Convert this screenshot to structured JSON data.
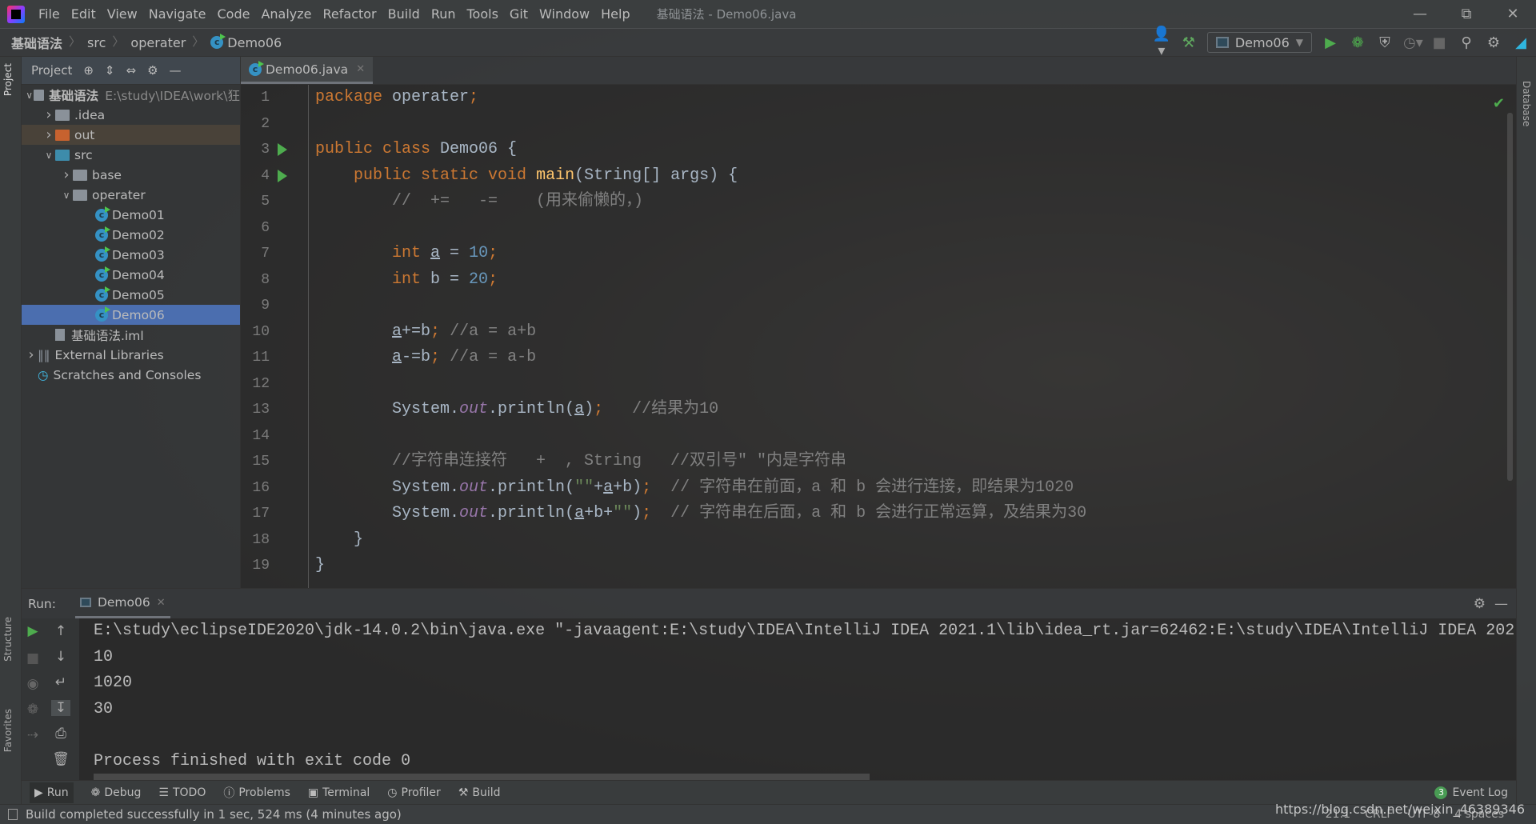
{
  "titlebar": {
    "menu": [
      "File",
      "Edit",
      "View",
      "Navigate",
      "Code",
      "Analyze",
      "Refactor",
      "Build",
      "Run",
      "Tools",
      "Git",
      "Window",
      "Help"
    ],
    "title": "基础语法 - Demo06.java"
  },
  "navbar": {
    "breadcrumbs": [
      "基础语法",
      "src",
      "operater",
      "Demo06"
    ],
    "run_config": "Demo06"
  },
  "side_tabs": {
    "project": "Project",
    "structure": "Structure",
    "favorites": "Favorites",
    "database": "Database"
  },
  "project": {
    "header": "Project",
    "tree": [
      {
        "label": "基础语法",
        "hint": "E:\\study\\IDEA\\work\\狂",
        "depth": 0,
        "arrow": "down",
        "icon": "module-folder"
      },
      {
        "label": ".idea",
        "depth": 1,
        "arrow": "right",
        "icon": "folder"
      },
      {
        "label": "out",
        "depth": 1,
        "arrow": "right",
        "icon": "folder-orange"
      },
      {
        "label": "src",
        "depth": 1,
        "arrow": "down",
        "icon": "folder-blue"
      },
      {
        "label": "base",
        "depth": 2,
        "arrow": "right",
        "icon": "package"
      },
      {
        "label": "operater",
        "depth": 2,
        "arrow": "down",
        "icon": "package"
      },
      {
        "label": "Demo01",
        "depth": 3,
        "icon": "class"
      },
      {
        "label": "Demo02",
        "depth": 3,
        "icon": "class"
      },
      {
        "label": "Demo03",
        "depth": 3,
        "icon": "class"
      },
      {
        "label": "Demo04",
        "depth": 3,
        "icon": "class"
      },
      {
        "label": "Demo05",
        "depth": 3,
        "icon": "class"
      },
      {
        "label": "Demo06",
        "depth": 3,
        "icon": "class",
        "selected": true
      },
      {
        "label": "基础语法.iml",
        "depth": 1,
        "icon": "iml-file"
      },
      {
        "label": "External Libraries",
        "depth": 0,
        "arrow": "right",
        "icon": "libraries"
      },
      {
        "label": "Scratches and Consoles",
        "depth": 0,
        "icon": "scratches"
      }
    ]
  },
  "editor": {
    "tab": "Demo06.java",
    "run_markers": [
      3,
      4
    ],
    "lines": [
      [
        [
          "kw",
          "package "
        ],
        [
          "t",
          "operater"
        ],
        [
          "kw",
          ";"
        ]
      ],
      [],
      [
        [
          "kw",
          "public class "
        ],
        [
          "t",
          "Demo06 {"
        ]
      ],
      [
        [
          "t",
          "    "
        ],
        [
          "kw",
          "public static void "
        ],
        [
          "fn",
          "main"
        ],
        [
          "t",
          "(String[] args) {"
        ]
      ],
      [
        [
          "cm",
          "        //  +=   -=    (用来偷懒的，)"
        ]
      ],
      [],
      [
        [
          "t",
          "        "
        ],
        [
          "kw",
          "int "
        ],
        [
          "var",
          "a"
        ],
        [
          "t",
          " = "
        ],
        [
          "num",
          "10"
        ],
        [
          "kw",
          ";"
        ]
      ],
      [
        [
          "t",
          "        "
        ],
        [
          "kw",
          "int "
        ],
        [
          "t",
          "b = "
        ],
        [
          "num",
          "20"
        ],
        [
          "kw",
          ";"
        ]
      ],
      [],
      [
        [
          "t",
          "        "
        ],
        [
          "var",
          "a"
        ],
        [
          "t",
          "+=b"
        ],
        [
          "kw",
          ";"
        ],
        [
          "cm",
          " //a = a+b"
        ]
      ],
      [
        [
          "t",
          "        "
        ],
        [
          "var",
          "a"
        ],
        [
          "t",
          "-=b"
        ],
        [
          "kw",
          ";"
        ],
        [
          "cm",
          " //a = a-b"
        ]
      ],
      [],
      [
        [
          "t",
          "        System."
        ],
        [
          "fld",
          "out"
        ],
        [
          "t",
          ".println("
        ],
        [
          "var",
          "a"
        ],
        [
          "t",
          ")"
        ],
        [
          "kw",
          ";"
        ],
        [
          "cm",
          "   //结果为10"
        ]
      ],
      [],
      [
        [
          "cm",
          "        //字符串连接符   +  , String   //双引号\" \"内是字符串"
        ]
      ],
      [
        [
          "t",
          "        System."
        ],
        [
          "fld",
          "out"
        ],
        [
          "t",
          ".println("
        ],
        [
          "str",
          "\"\""
        ],
        [
          "t",
          "+"
        ],
        [
          "var",
          "a"
        ],
        [
          "t",
          "+b)"
        ],
        [
          "kw",
          ";"
        ],
        [
          "cm",
          "  // 字符串在前面，a 和 b 会进行连接，即结果为1020"
        ]
      ],
      [
        [
          "t",
          "        System."
        ],
        [
          "fld",
          "out"
        ],
        [
          "t",
          ".println("
        ],
        [
          "var",
          "a"
        ],
        [
          "t",
          "+b+"
        ],
        [
          "str",
          "\"\""
        ],
        [
          "t",
          ")"
        ],
        [
          "kw",
          ";"
        ],
        [
          "cm",
          "  // 字符串在后面，a 和 b 会进行正常运算，及结果为30"
        ]
      ],
      [
        [
          "t",
          "    }"
        ]
      ],
      [
        [
          "t",
          "}"
        ]
      ]
    ]
  },
  "run": {
    "label": "Run:",
    "tab": "Demo06",
    "output": [
      "E:\\study\\eclipseIDE2020\\jdk-14.0.2\\bin\\java.exe \"-javaagent:E:\\study\\IDEA\\IntelliJ IDEA 2021.1\\lib\\idea_rt.jar=62462:E:\\study\\IDEA\\IntelliJ IDEA 202",
      "10",
      "1020",
      "30",
      "",
      "Process finished with exit code 0"
    ]
  },
  "bottom_tabs": [
    "Run",
    "Debug",
    "TODO",
    "Problems",
    "Terminal",
    "Profiler",
    "Build"
  ],
  "event_log": {
    "count": "3",
    "label": "Event Log"
  },
  "status": {
    "message": "Build completed successfully in 1 sec, 524 ms (4 minutes ago)",
    "position": "21:1",
    "line_sep": "CRLF",
    "encoding": "UTF-8",
    "indent": "4 spaces",
    "watermark": "https://blog.csdn.net/weixin_46389346"
  },
  "colors": {
    "keyword": "#cc7832",
    "number": "#6897bb",
    "comment": "#808080",
    "field": "#9876aa",
    "method": "#ffc66d",
    "selection": "#4b6eaf",
    "run_green": "#4eac4e"
  }
}
